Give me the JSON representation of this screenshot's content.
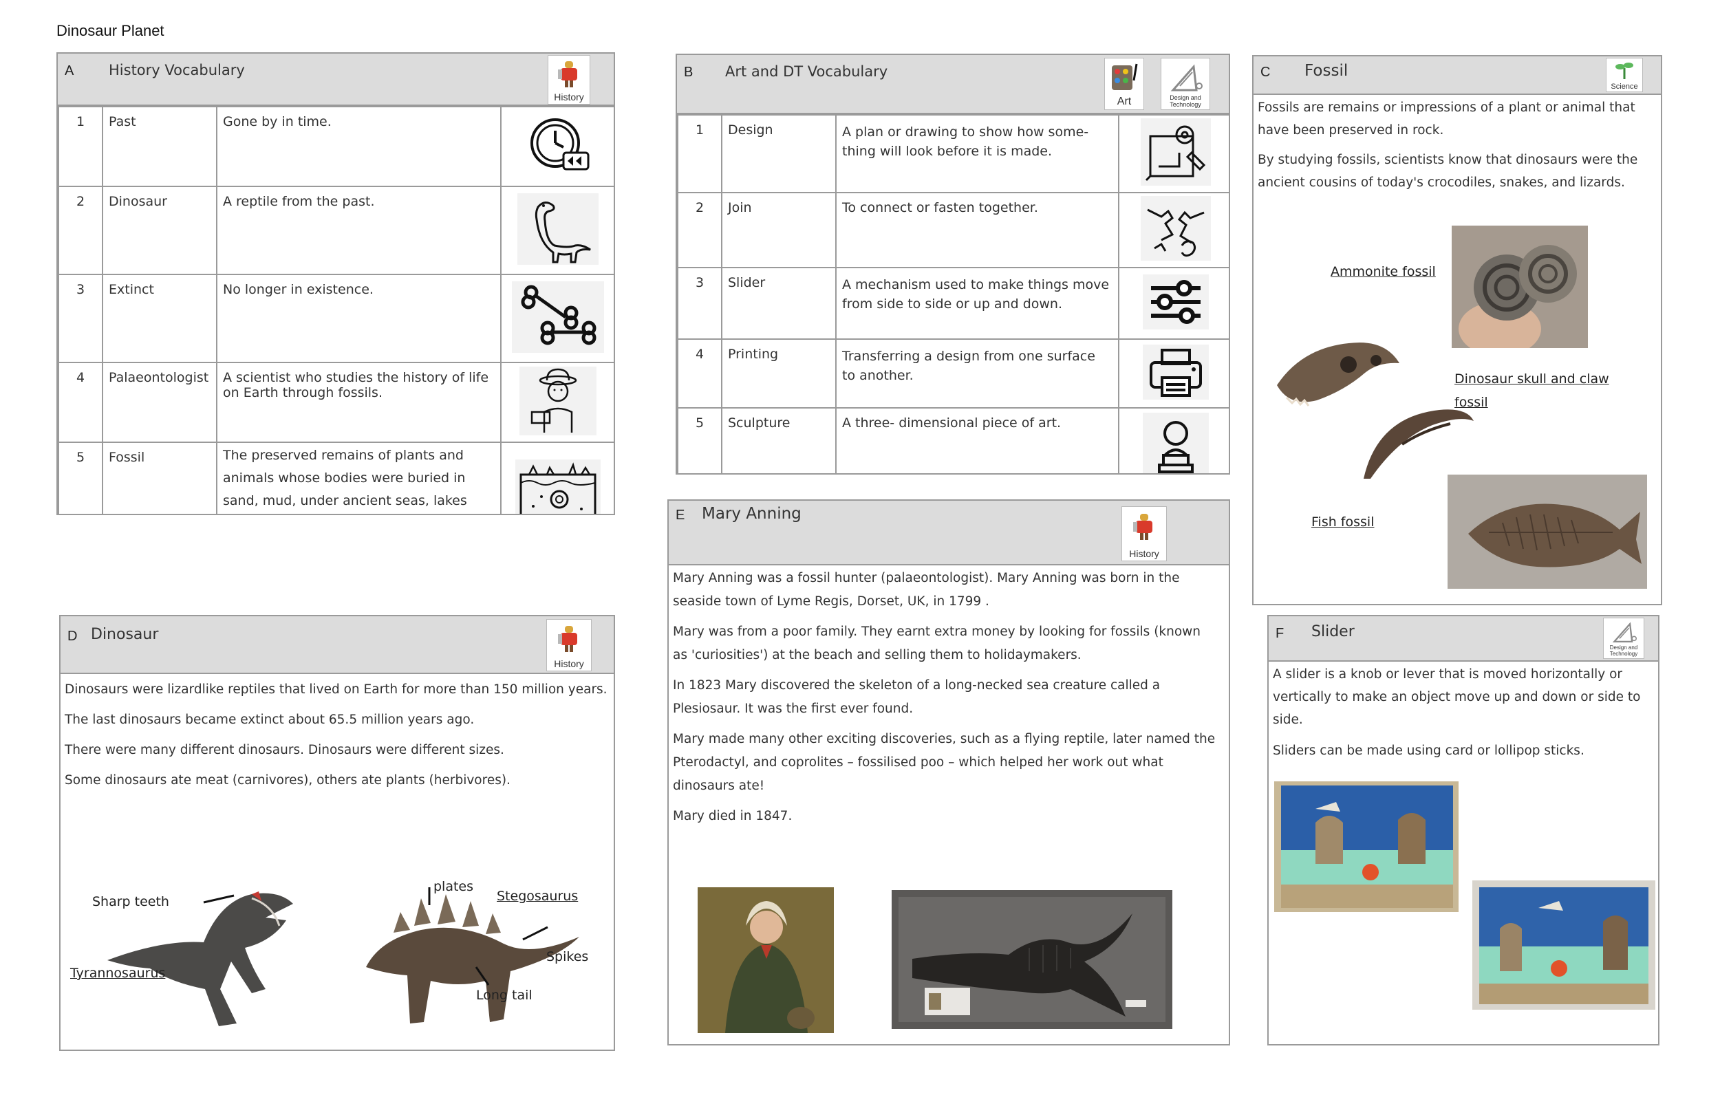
{
  "document": {
    "title": "Dinosaur Planet"
  },
  "panel_a": {
    "letter": "A",
    "title": "History Vocabulary",
    "badge": "History",
    "rows": [
      {
        "num": "1",
        "term": "Past",
        "def": "Gone by in time.",
        "icon": "clock-rewind-icon"
      },
      {
        "num": "2",
        "term": "Dinosaur",
        "def": "A reptile from the past.",
        "icon": "dinosaur-icon"
      },
      {
        "num": "3",
        "term": "Extinct",
        "def": "No longer in existence.",
        "icon": "bones-icon"
      },
      {
        "num": "4",
        "term": "Palaeontologist",
        "def": "A scientist who studies the history of life on Earth through fossils.",
        "icon": "palaeontologist-icon"
      },
      {
        "num": "5",
        "term": "Fossil",
        "def": "The preserved remains of plants and animals whose bodies were buried in sand, mud, under ancient seas, lakes and rivers.",
        "icon": "fossil-layer-icon"
      }
    ]
  },
  "panel_b": {
    "letter": "B",
    "title": "Art and DT Vocabulary",
    "badge_art": "Art",
    "badge_dt": "Design and Technology",
    "rows": [
      {
        "num": "1",
        "term": "Design",
        "def": "A plan or drawing to show how some-thing will look before it is made.",
        "icon": "design-plan-icon"
      },
      {
        "num": "2",
        "term": "Join",
        "def": "To connect or fasten together.",
        "icon": "join-icon"
      },
      {
        "num": "3",
        "term": "Slider",
        "def": "A mechanism used to make things move from side to side or up and down.",
        "icon": "slider-icon"
      },
      {
        "num": "4",
        "term": "Printing",
        "def": "Transferring a design from one surface to another.",
        "icon": "printer-icon"
      },
      {
        "num": "5",
        "term": "Sculpture",
        "def": "A three- dimensional piece of art.",
        "icon": "sculpture-icon"
      }
    ]
  },
  "panel_c": {
    "letter": "C",
    "title": "Fossil",
    "badge": "Science",
    "paragraphs": [
      "Fossils are remains or impressions of a plant or animal that have been preserved in rock.",
      "By studying  fossils, scientists know that dinosaurs were the ancient cousins of today's crocodiles, snakes, and lizards."
    ],
    "labels": {
      "ammonite": "Ammonite fossil",
      "skull": "Dinosaur skull and claw fossil",
      "fish": "Fish fossil"
    }
  },
  "panel_d": {
    "letter": "D",
    "title": "Dinosaur",
    "badge": "History",
    "paragraphs": [
      "Dinosaurs were lizardlike reptiles that lived on Earth for more than 150 million years.",
      "The last dinosaurs became extinct about 65.5 million years ago.",
      "There were many different dinosaurs. Dinosaurs were different sizes.",
      "Some dinosaurs ate meat (carnivores), others ate plants (herbivores)."
    ],
    "labels": {
      "sharp_teeth": "Sharp teeth",
      "tyrannosaurus": "Tyrannosaurus",
      "plates": "plates",
      "stegosaurus": "Stegosaurus",
      "spikes": "Spikes",
      "long_tail": "Long tail"
    }
  },
  "panel_e": {
    "letter": "E",
    "title": "Mary Anning",
    "badge": "History",
    "paragraphs": [
      "Mary Anning was a fossil hunter (palaeontologist). Mary Anning was born in the seaside town of Lyme Regis, Dorset, UK, in 1799 .",
      "Mary  was from a poor family. They earnt extra money by looking for fossils (known as 'curiosities') at the beach and selling them to holidaymakers.",
      "In 1823 Mary discovered the skeleton of a long-necked sea creature called a Plesiosaur. It was the first ever found.",
      "Mary made many other exciting discoveries, such as a flying reptile, later named the Pterodactyl, and coprolites – fossilised poo – which helped her work out what dinosaurs ate!",
      "Mary died in 1847."
    ]
  },
  "panel_f": {
    "letter": "F",
    "title": "Slider",
    "badge": "Design and Technology",
    "paragraphs": [
      "A slider is a knob or lever that is moved horizontally or vertically to make an object move up and down or side to side.",
      "Sliders can be made using card or lollipop sticks."
    ]
  }
}
